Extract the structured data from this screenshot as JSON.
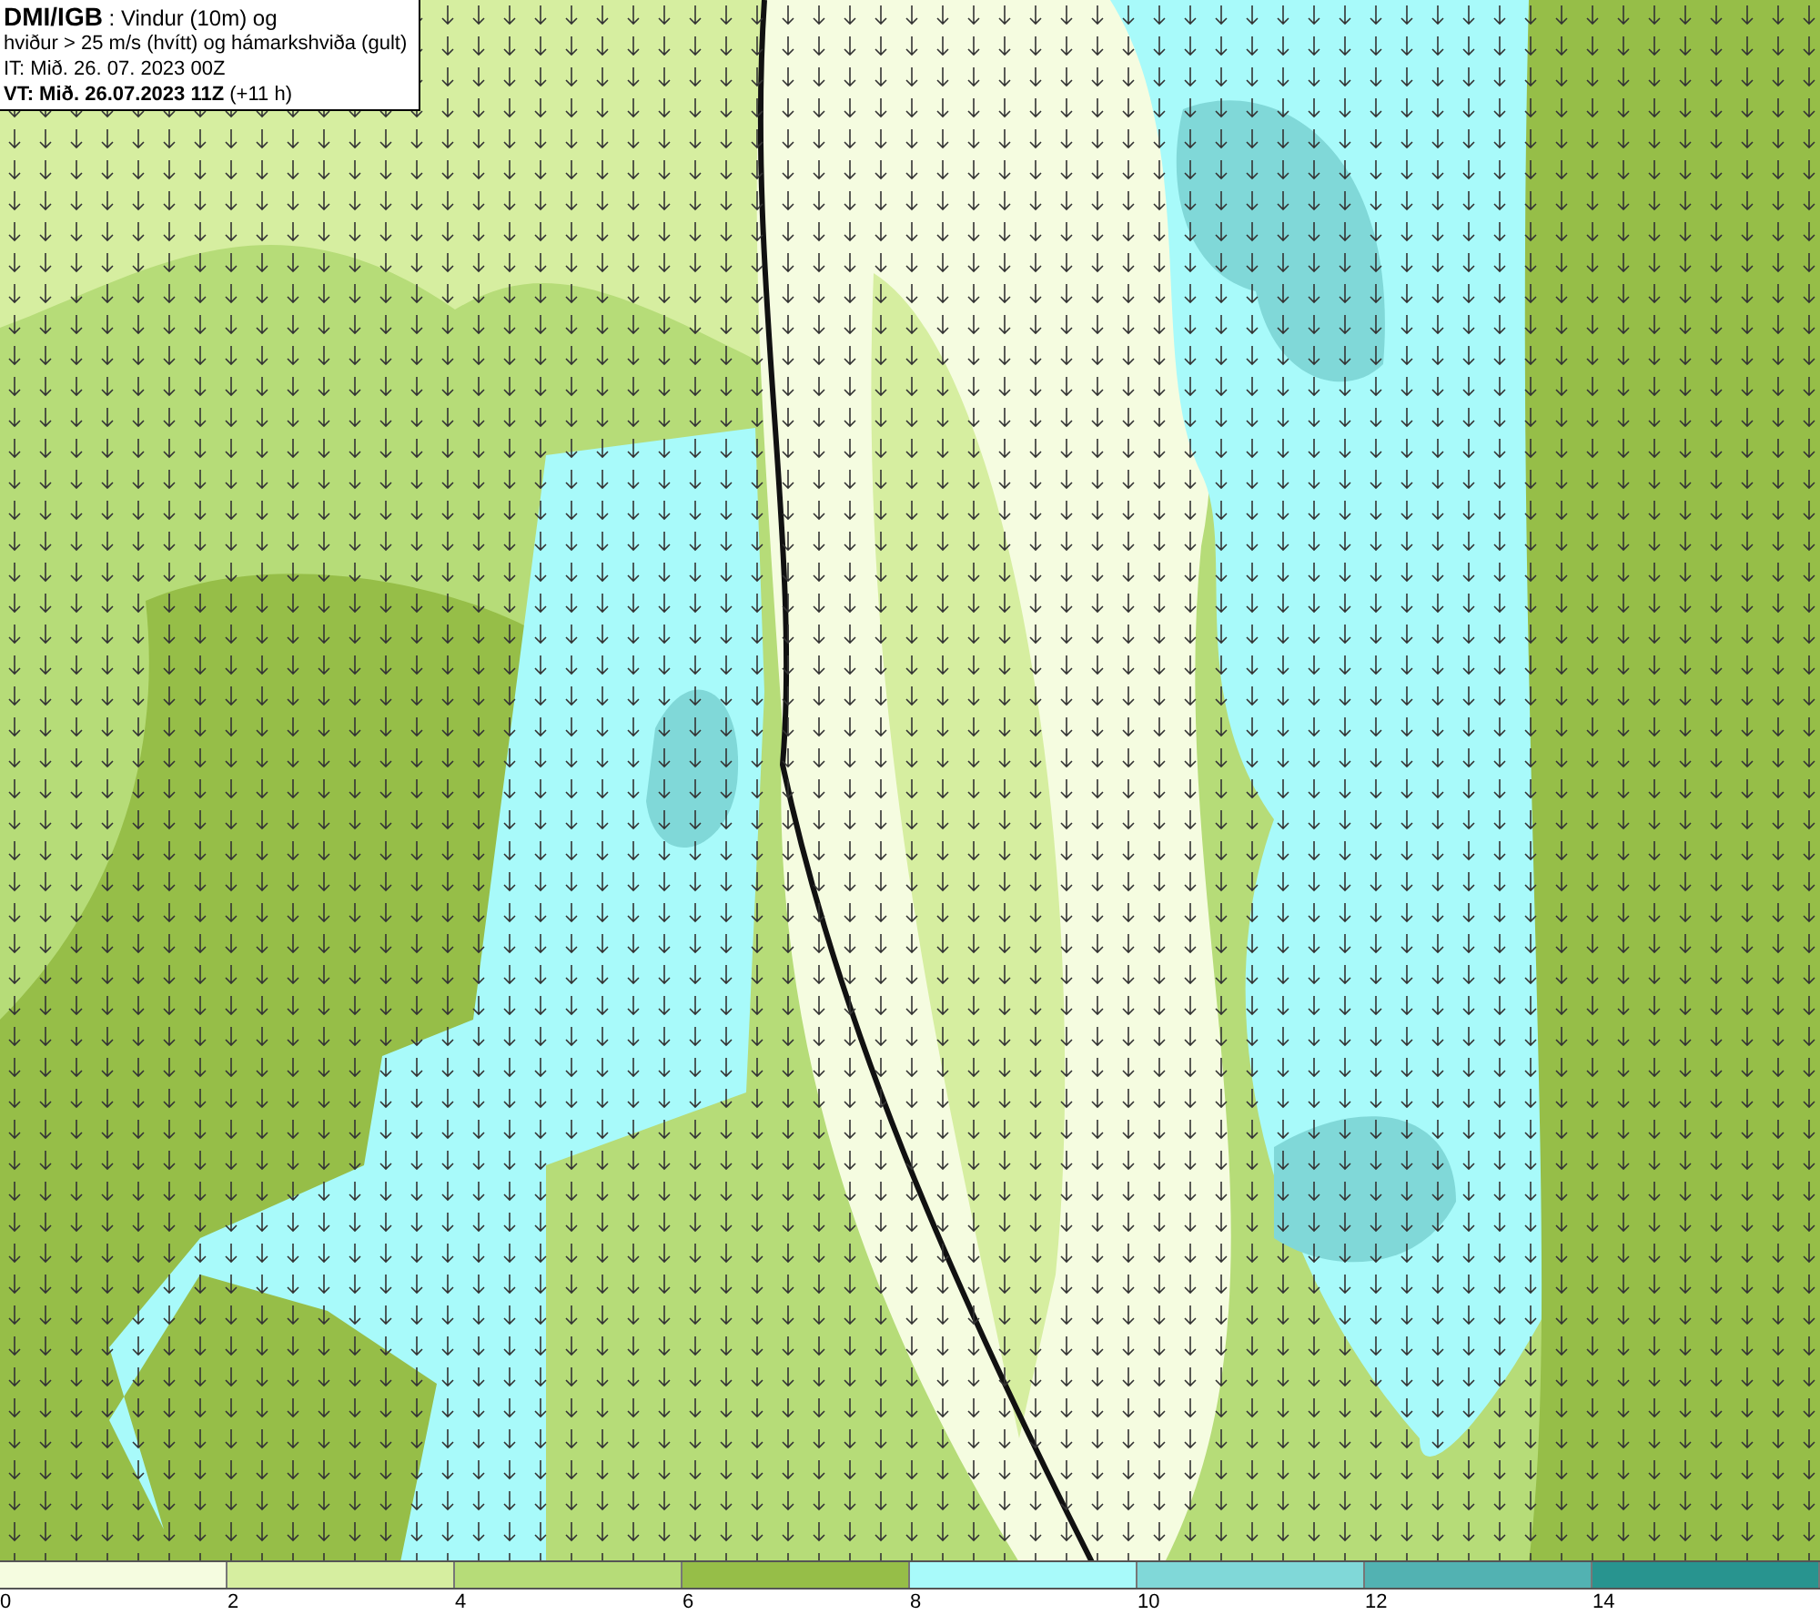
{
  "header": {
    "lines": [
      "**DMI/IGB** : Vindur (10m) og",
      "hviður > 25 m/s (hvítt) og hámarkshviða (gult)",
      "IT: Mið. 26. 07. 2023 00Z",
      "**VT: Mið. 26.07.2023 11Z** (+11 h)"
    ]
  },
  "legend": [
    {
      "label": "0",
      "color": "#f5fce0"
    },
    {
      "label": "2",
      "color": "#d6eea0"
    },
    {
      "label": "4",
      "color": "#b6dc78"
    },
    {
      "label": "6",
      "color": "#96be48"
    },
    {
      "label": "8",
      "color": "#a8fafa"
    },
    {
      "label": "10",
      "color": "#80d8d8"
    },
    {
      "label": "12",
      "color": "#52b2b2"
    },
    {
      "label": "14",
      "color": "#28948f"
    }
  ]
}
